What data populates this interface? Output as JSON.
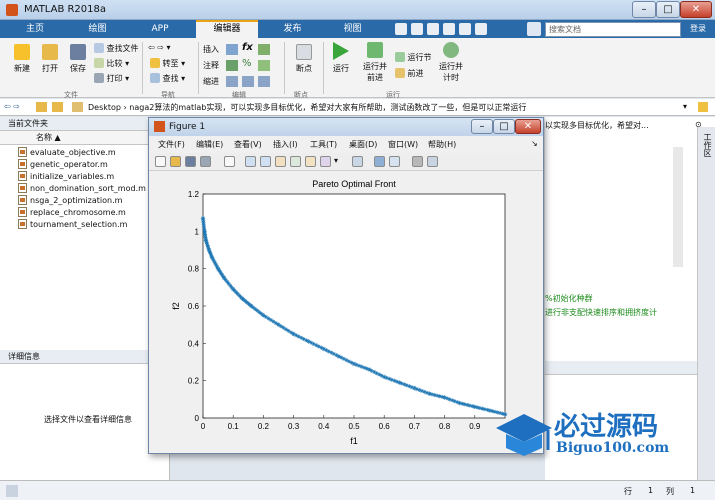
{
  "app": {
    "title": "MATLAB R2018a",
    "tabs": [
      "主页",
      "绘图",
      "APP",
      "编辑器",
      "发布",
      "视图"
    ],
    "search_placeholder": "搜索文档",
    "signin": "登录"
  },
  "toolstrip": {
    "new": "新建",
    "open": "打开",
    "save": "保存",
    "find_files": "查找文件",
    "compare": "比较",
    "print": "打印",
    "goto": "转至",
    "find": "查找",
    "insert": "插入",
    "comment": "注释",
    "indent": "缩进",
    "breakpoints": "断点",
    "run": "运行",
    "run_advance_l1": "运行并",
    "run_advance_l2": "前进",
    "run_section": "运行节",
    "advance": "前进",
    "run_time_l1": "运行并",
    "run_time_l2": "计时",
    "sections": {
      "file": "文件",
      "navigate": "导航",
      "edit": "编辑",
      "breakpoints": "断点",
      "run": "运行"
    }
  },
  "address": {
    "path": "Desktop › naga2算法的matlab实现，可以实现多目标优化，希望对大家有所帮助，测试函数改了一些，但是可以正常运行"
  },
  "current_folder": {
    "title": "当前文件夹",
    "column_name": "名称",
    "files": [
      "evaluate_objective.m",
      "genetic_operator.m",
      "initialize_variables.m",
      "non_domination_sort_mod.m",
      "nsga_2_optimization.m",
      "replace_chromosome.m",
      "tournament_selection.m"
    ]
  },
  "details": {
    "title": "详细信息",
    "empty_msg": "选择文件以查看详细信息"
  },
  "right": {
    "workspace": "工作区",
    "editor_tab_text": "以实现多目标优化，希望对...",
    "code_line1": "%初始化种群",
    "code_line2": "进行非支配快速排序和拥挤度计"
  },
  "status": {
    "row_label": "行",
    "row": "1",
    "col_label": "列",
    "col": "1"
  },
  "figure": {
    "title": "Figure 1",
    "menu": [
      "文件(F)",
      "编辑(E)",
      "查看(V)",
      "插入(I)",
      "工具(T)",
      "桌面(D)",
      "窗口(W)",
      "帮助(H)"
    ]
  },
  "logo": {
    "cn": "必过源码",
    "url": "Biguo100.com"
  },
  "colors": {
    "accent_tab": "#2b6aa8",
    "series": "#1f77b4"
  },
  "chart_data": {
    "type": "scatter",
    "title": "Pareto Optimal Front",
    "xlabel": "f1",
    "ylabel": "f2",
    "xlim": [
      0,
      1
    ],
    "ylim": [
      0,
      1.2
    ],
    "xticks": [
      0,
      0.1,
      0.2,
      0.3,
      0.4,
      0.5,
      0.6,
      0.7,
      0.8,
      0.9
    ],
    "yticks": [
      0,
      0.2,
      0.4,
      0.6,
      0.8,
      1,
      1.2
    ],
    "series": [
      {
        "marker": "*",
        "x": [
          0.0,
          0.005,
          0.01,
          0.02,
          0.03,
          0.05,
          0.07,
          0.1,
          0.13,
          0.16,
          0.2,
          0.25,
          0.3,
          0.35,
          0.4,
          0.45,
          0.5,
          0.55,
          0.6,
          0.65,
          0.7,
          0.75,
          0.8,
          0.85,
          0.9,
          0.95,
          1.0
        ],
        "y": [
          1.07,
          1.0,
          0.95,
          0.9,
          0.86,
          0.8,
          0.75,
          0.69,
          0.64,
          0.6,
          0.55,
          0.5,
          0.45,
          0.41,
          0.37,
          0.33,
          0.29,
          0.26,
          0.22,
          0.19,
          0.16,
          0.13,
          0.11,
          0.08,
          0.06,
          0.04,
          0.02
        ]
      }
    ]
  }
}
